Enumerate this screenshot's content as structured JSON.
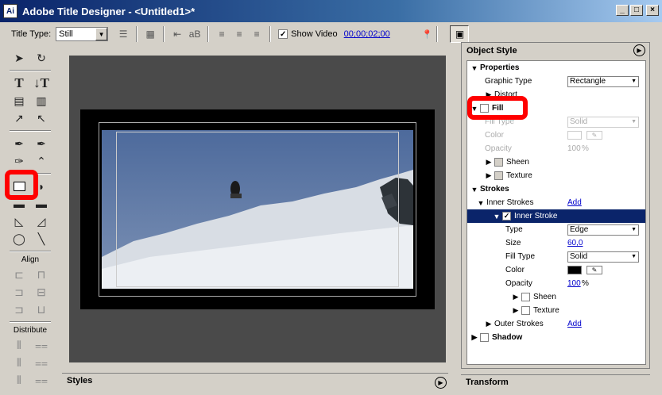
{
  "window": {
    "title": "Adobe Title Designer - <Untitled1>*",
    "app_icon": "Ai",
    "minimize": "_",
    "maximize": "□",
    "close": "×"
  },
  "toolbar": {
    "title_type_label": "Title Type:",
    "title_type_value": "Still",
    "show_video_label": "Show Video",
    "show_video_checked": "✓",
    "timecode": "00;00;02;00"
  },
  "tools": {
    "align_label": "Align",
    "distribute_label": "Distribute"
  },
  "object_style": {
    "title": "Object Style",
    "properties": {
      "label": "Properties",
      "graphic_type_label": "Graphic Type",
      "graphic_type_value": "Rectangle",
      "distort_label": "Distort"
    },
    "fill": {
      "label": "Fill",
      "fill_type_label": "Fill Type",
      "fill_type_value": "Solid",
      "color_label": "Color",
      "opacity_label": "Opacity",
      "opacity_value": "100",
      "opacity_unit": "%",
      "sheen_label": "Sheen",
      "texture_label": "Texture"
    },
    "strokes": {
      "label": "Strokes",
      "inner_strokes_label": "Inner Strokes",
      "add_label": "Add",
      "inner_stroke_label": "Inner Stroke",
      "inner_stroke_checked": "✓",
      "type_label": "Type",
      "type_value": "Edge",
      "size_label": "Size",
      "size_value": "60,0",
      "fill_type_label": "Fill Type",
      "fill_type_value": "Solid",
      "color_label": "Color",
      "stroke_color": "#000000",
      "opacity_label": "Opacity",
      "opacity_value": "100",
      "opacity_unit": "%",
      "sheen_label": "Sheen",
      "texture_label": "Texture",
      "outer_strokes_label": "Outer Strokes",
      "outer_add_label": "Add"
    },
    "shadow_label": "Shadow"
  },
  "styles": {
    "title": "Styles"
  },
  "transform": {
    "title": "Transform"
  }
}
